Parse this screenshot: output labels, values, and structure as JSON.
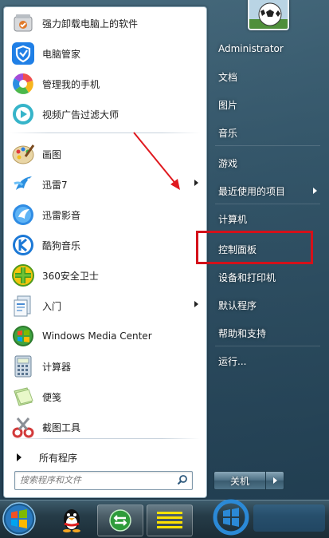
{
  "start_menu": {
    "pinned": [
      {
        "label": "强力卸载电脑上的软件",
        "icon": "uninstall-icon"
      },
      {
        "label": "电脑管家",
        "icon": "shield-icon"
      },
      {
        "label": "管理我的手机",
        "icon": "phone-manager-icon"
      },
      {
        "label": "视频广告过滤大师",
        "icon": "ad-filter-icon"
      }
    ],
    "recent": [
      {
        "label": "画图",
        "icon": "paint-icon",
        "submenu": false
      },
      {
        "label": "迅雷7",
        "icon": "thunder-icon",
        "submenu": true
      },
      {
        "label": "迅雷影音",
        "icon": "thunder-player-icon",
        "submenu": false
      },
      {
        "label": "酷狗音乐",
        "icon": "kugou-icon",
        "submenu": false
      },
      {
        "label": "360安全卫士",
        "icon": "360-icon",
        "submenu": false
      },
      {
        "label": "入门",
        "icon": "getting-started-icon",
        "submenu": true
      },
      {
        "label": "Windows Media Center",
        "icon": "media-center-icon",
        "submenu": false
      },
      {
        "label": "计算器",
        "icon": "calculator-icon",
        "submenu": false
      },
      {
        "label": "便笺",
        "icon": "sticky-notes-icon",
        "submenu": false
      },
      {
        "label": "截图工具",
        "icon": "snipping-tool-icon",
        "submenu": false
      }
    ],
    "all_programs_label": "所有程序",
    "search": {
      "placeholder": "搜索程序和文件"
    },
    "right": [
      {
        "label": "Administrator",
        "submenu": false
      },
      {
        "label": "文档",
        "submenu": false
      },
      {
        "label": "图片",
        "submenu": false
      },
      {
        "label": "音乐",
        "submenu": false
      },
      {
        "label": "游戏",
        "submenu": false
      },
      {
        "label": "最近使用的项目",
        "submenu": true
      },
      {
        "label": "计算机",
        "submenu": false
      },
      {
        "label": "控制面板",
        "submenu": false
      },
      {
        "label": "设备和打印机",
        "submenu": false
      },
      {
        "label": "默认程序",
        "submenu": false
      },
      {
        "label": "帮助和支持",
        "submenu": false
      },
      {
        "label": "运行...",
        "submenu": false
      }
    ],
    "shutdown_label": "关机"
  },
  "colors": {
    "highlight": "#d4111a",
    "arrow": "#e0191f"
  }
}
